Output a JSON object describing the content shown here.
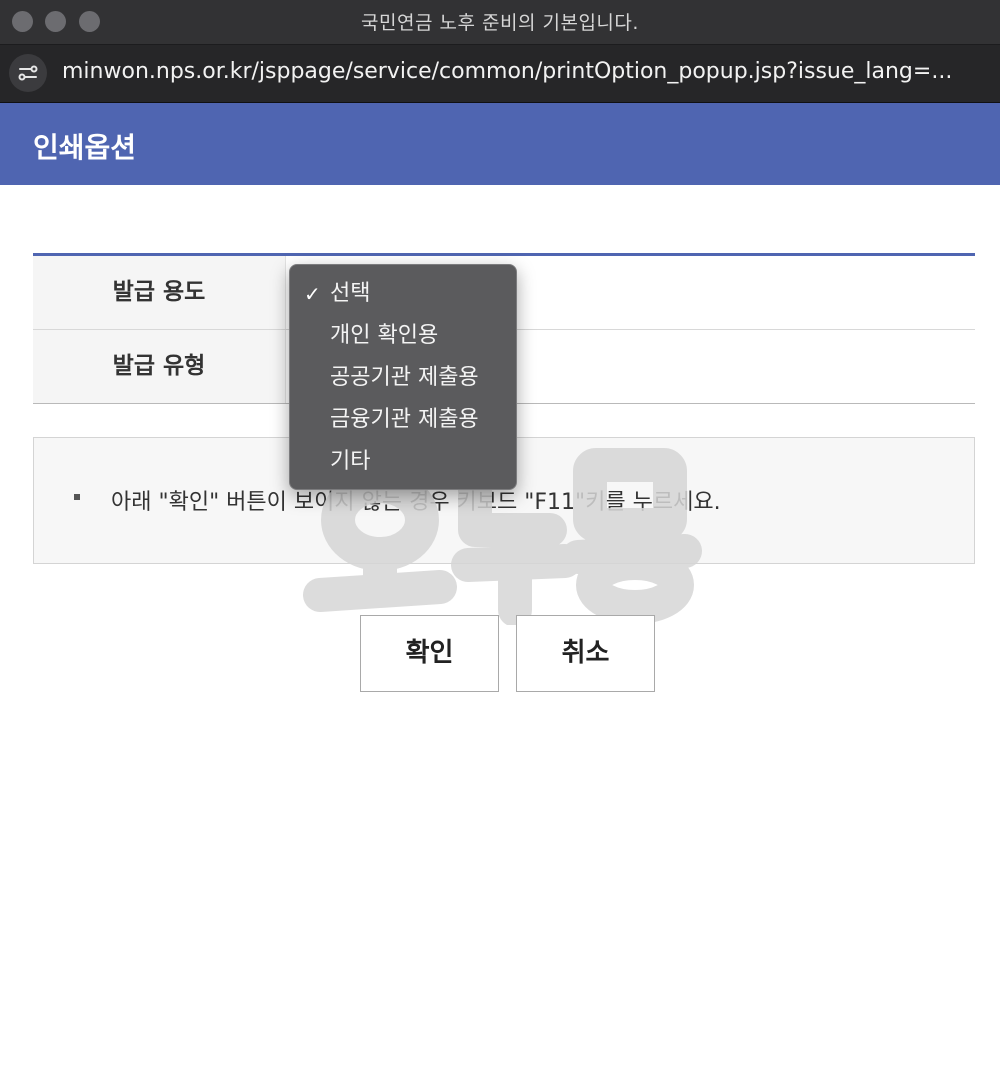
{
  "window": {
    "title": "국민연금 노후 준비의 기본입니다."
  },
  "urlbar": {
    "url": "minwon.nps.or.kr/jsppage/service/common/printOption_popup.jsp?issue_lang=..."
  },
  "header": {
    "title": "인쇄옵션"
  },
  "form": {
    "rows": [
      {
        "label": "발급 용도"
      },
      {
        "label": "발급 유형"
      }
    ]
  },
  "dropdown": {
    "selected_index": 0,
    "check_glyph": "✓",
    "options": [
      {
        "label": "선택"
      },
      {
        "label": "개인 확인용"
      },
      {
        "label": "공공기관 제출용"
      },
      {
        "label": "금융기관 제출용"
      },
      {
        "label": "기타"
      }
    ]
  },
  "notice": {
    "text": "아래 \"확인\" 버튼이 보이지 않는 경우 키보드 \"F11\"키를 누르세요."
  },
  "buttons": {
    "ok_label": "확인",
    "cancel_label": "취소"
  },
  "watermark": {
    "text": "오두몽"
  },
  "colors": {
    "accent": "#4f65b1",
    "titlebar": "#323234",
    "urlbar": "#262628",
    "dropdown_bg": "#5b5b5d"
  }
}
